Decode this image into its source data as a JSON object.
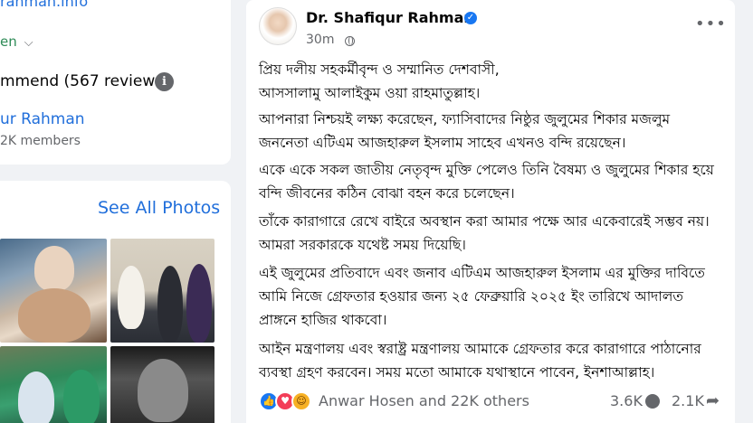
{
  "left_panel": {
    "page_link": "rahman.info",
    "status_text": "en",
    "recommend_text": "mmend (567 reviews)",
    "group_name": "ur Rahman",
    "group_members": "2K members",
    "see_all_photos": "See All Photos"
  },
  "post": {
    "author": "Dr. Shafiqur Rahman",
    "time": "30m",
    "paragraphs": [
      [
        "প্রিয় দলীয় সহকর্মীবৃন্দ ও সম্মানিত দেশবাসী,",
        "আসসালামু আলাইকুম ওয়া রাহমাতুল্লাহ।"
      ],
      [
        "আপনারা নিশ্চয়ই লক্ষ্য করেছেন, ফ্যাসিবাদের নিষ্ঠুর জুলুমের শিকার মজলুম",
        "জননেতা এটিএম আজহারুল ইসলাম সাহেব এখনও বন্দি রয়েছেন।"
      ],
      [
        "একে একে সকল জাতীয় নেতৃবৃন্দ মুক্তি পেলেও তিনি বৈষম্য ও জুলুমের শিকার হয়ে",
        "বন্দি জীবনের কঠিন বোঝা বহন করে চলেছেন।"
      ],
      [
        "তাঁকে কারাগারে রেখে বাইরে অবস্থান করা আমার পক্ষে আর একেবারেই সম্ভব নয়।",
        "আমরা সরকারকে যথেষ্ট সময় দিয়েছি।"
      ],
      [
        "এই জুলুমের প্রতিবাদে এবং জনাব এটিএম আজহারুল ইসলাম এর মুক্তির দাবিতে",
        "আমি নিজে গ্রেফতার হওয়ার জন্য ২৫ ফেব্রুয়ারি ২০২৫ ইং তারিখে আদালত",
        "প্রাঙ্গনে হাজির থাকবো।"
      ],
      [
        "আইন মন্ত্রণালয় এবং স্বরাষ্ট্র মন্ত্রণালয় আমাকে গ্রেফতার করে কারাগারে পাঠানোর",
        "ব্যবস্থা গ্রহণ করবেন। সময় মতো আমাকে যথাস্থানে পাবেন, ইনশাআল্লাহ।"
      ]
    ],
    "reactions_text": "Anwar Hosen and 22K others",
    "comments_count": "3.6K",
    "shares_count": "2.1K"
  }
}
